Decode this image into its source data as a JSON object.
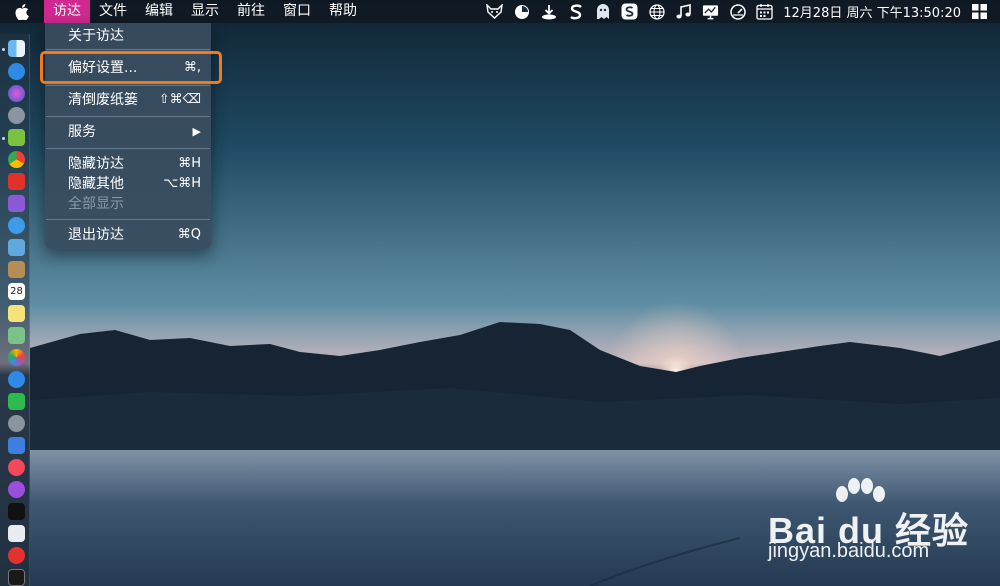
{
  "menubar": {
    "apple_icon": "apple-logo-icon",
    "items": [
      "访达",
      "文件",
      "编辑",
      "显示",
      "前往",
      "窗口",
      "帮助"
    ],
    "active_index": 0,
    "status_icons": [
      "fox-icon",
      "pie-chart-icon",
      "download-icon",
      "s-app-icon",
      "ghost-icon",
      "s-box-icon",
      "globe-icon",
      "music-note-icon",
      "display-icon",
      "speedometer-icon",
      "calendar-icon"
    ],
    "clock": "12月28日 周六 下午13:50:20",
    "windows_icon": "windows-logo-icon"
  },
  "dropdown": {
    "about": "关于访达",
    "preferences": {
      "label": "偏好设置...",
      "shortcut": "⌘,"
    },
    "empty_trash": {
      "label": "清倒废纸篓",
      "shortcut": "⇧⌘⌫"
    },
    "services": {
      "label": "服务",
      "arrow": "▶"
    },
    "hide": {
      "label": "隐藏访达",
      "shortcut": "⌘H"
    },
    "hide_others": {
      "label": "隐藏其他",
      "shortcut": "⌥⌘H"
    },
    "show_all": "全部显示",
    "quit": {
      "label": "退出访达",
      "shortcut": "⌘Q"
    }
  },
  "highlight_color": "#f07b1f",
  "dock": {
    "calendar_day": "28",
    "icons": [
      "finder-icon",
      "app-store-icon",
      "siri-icon",
      "launchpad-icon",
      "android-icon",
      "chrome-icon",
      "red-app-icon",
      "purple-app-icon",
      "safari-icon",
      "preview-icon",
      "notes-brown-icon",
      "calendar-icon",
      "notes-icon",
      "maps-icon",
      "photos-icon",
      "messages-icon",
      "wechat-icon",
      "settings-icon",
      "keynote-icon",
      "music-icon",
      "podcasts-icon",
      "apple-tv-icon",
      "cleaner-icon",
      "vivaldi-icon",
      "terminal-icon"
    ]
  },
  "watermark": {
    "brand": "Bai du 经验",
    "site": "jingyan.baidu.com"
  }
}
